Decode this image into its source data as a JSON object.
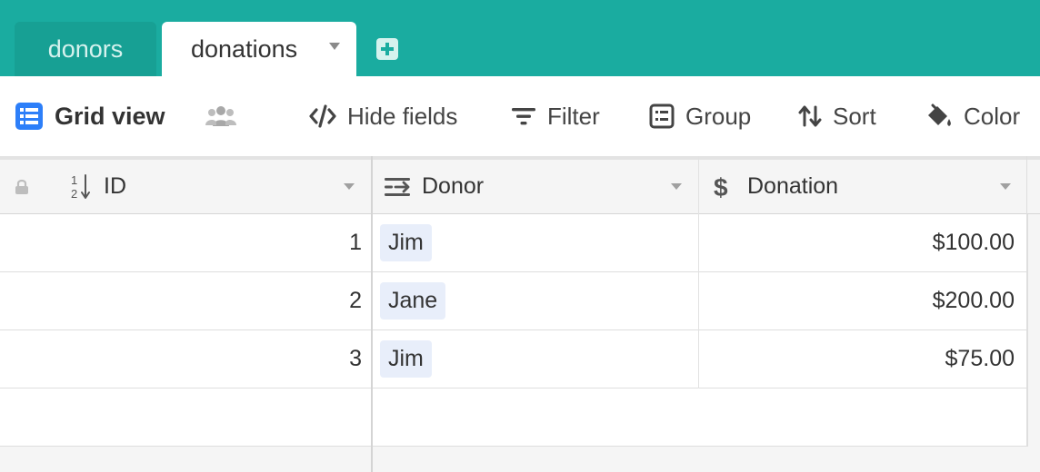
{
  "tabs": [
    {
      "label": "donors",
      "active": false
    },
    {
      "label": "donations",
      "active": true
    }
  ],
  "toolbar": {
    "view_name": "Grid view",
    "hide_fields": "Hide fields",
    "filter": "Filter",
    "group": "Group",
    "sort": "Sort",
    "color": "Color"
  },
  "columns": [
    {
      "label": "ID",
      "icon": "number-icon"
    },
    {
      "label": "Donor",
      "icon": "link-record-icon"
    },
    {
      "label": "Donation",
      "icon": "currency-icon"
    }
  ],
  "rows": [
    {
      "id": "1",
      "donor": "Jim",
      "donation": "$100.00"
    },
    {
      "id": "2",
      "donor": "Jane",
      "donation": "$200.00"
    },
    {
      "id": "3",
      "donor": "Jim",
      "donation": "$75.00"
    }
  ],
  "colors": {
    "brand": "#1aaca0",
    "view_icon": "#2d7ff9",
    "chip": "#e8eefa"
  }
}
